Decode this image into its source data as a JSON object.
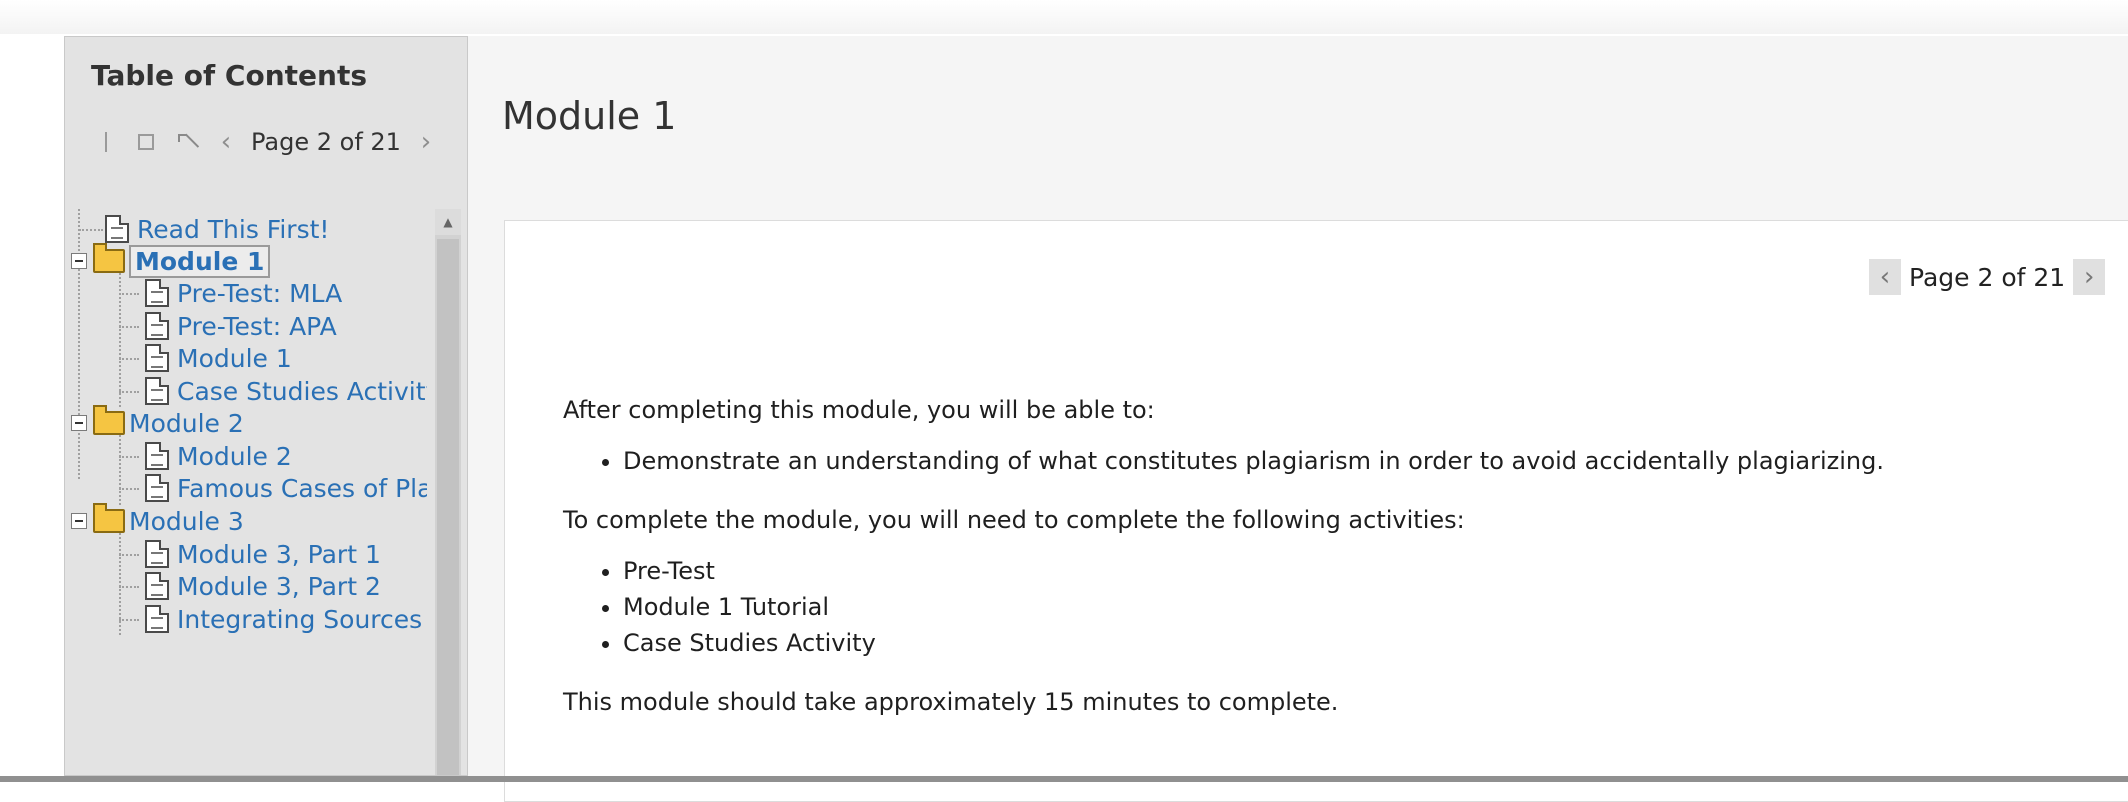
{
  "sidebar": {
    "title": "Table of Contents",
    "page_indicator": "Page 2 of 21",
    "items": [
      {
        "label": "Read This First!",
        "type": "document"
      },
      {
        "label": "Module 1",
        "type": "folder",
        "selected": true
      },
      {
        "label": "Pre-Test: MLA",
        "type": "document"
      },
      {
        "label": "Pre-Test: APA",
        "type": "document"
      },
      {
        "label": "Module 1",
        "type": "document"
      },
      {
        "label": "Case Studies Activity",
        "type": "document"
      },
      {
        "label": "Module 2",
        "type": "folder"
      },
      {
        "label": "Module 2",
        "type": "document"
      },
      {
        "label": "Famous Cases of Plag",
        "type": "document"
      },
      {
        "label": "Module 3",
        "type": "folder"
      },
      {
        "label": "Module 3, Part 1",
        "type": "document"
      },
      {
        "label": "Module 3, Part 2",
        "type": "document"
      },
      {
        "label": "Integrating Sources A",
        "type": "document"
      }
    ]
  },
  "main": {
    "title": "Module 1",
    "pager": {
      "text": "Page 2 of 21"
    },
    "intro": "After completing this module, you will be able to:",
    "objectives": [
      "Demonstrate an understanding of what constitutes plagiarism in order to avoid accidentally plagiarizing."
    ],
    "activities_intro": "To complete the module, you will need to complete the following activities:",
    "activities": [
      "Pre-Test",
      "Module 1 Tutorial",
      "Case Studies Activity"
    ],
    "duration": "This module should take approximately 15 minutes to complete."
  },
  "colors": {
    "link": "#2a70b5",
    "sidebar_bg": "#e3e3e3",
    "folder": "#f5c542"
  }
}
